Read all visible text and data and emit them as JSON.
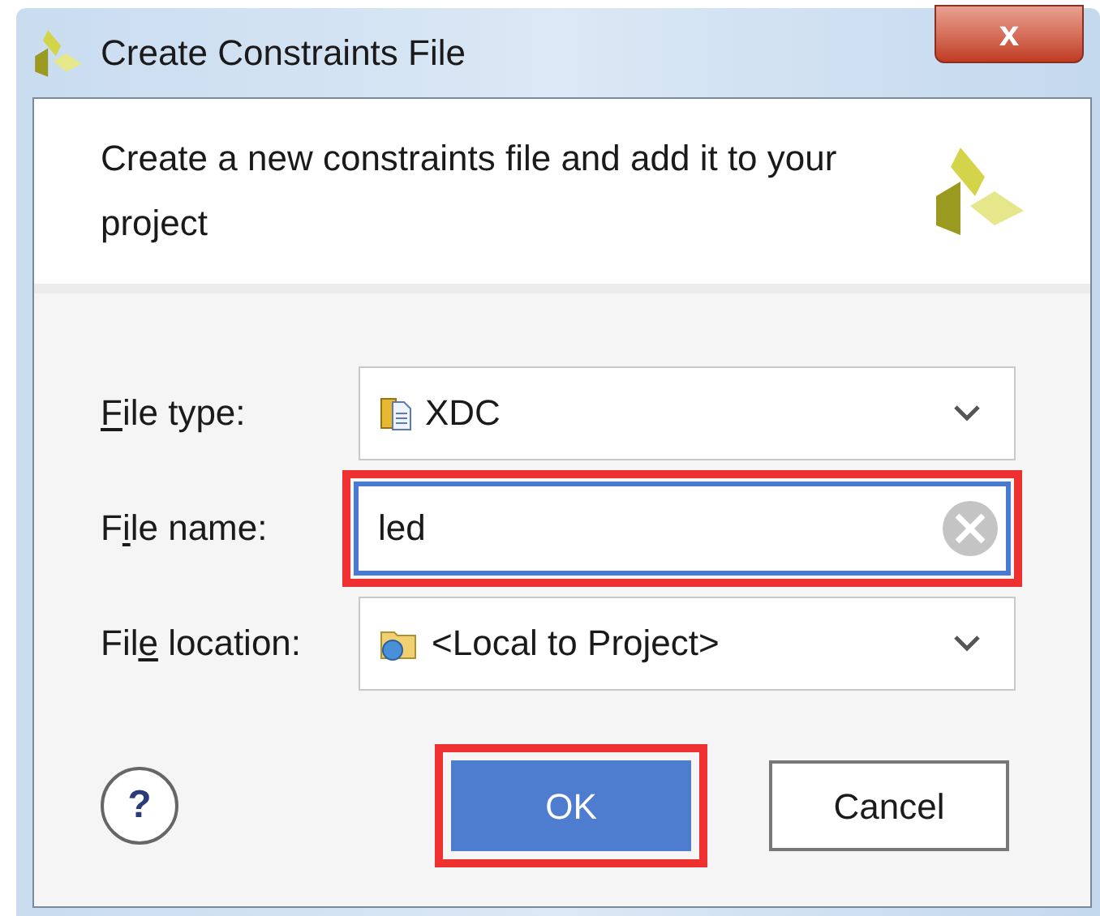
{
  "window": {
    "title": "Create Constraints File",
    "close": "x"
  },
  "header": {
    "text": "Create a new constraints file and add it to your project"
  },
  "fields": [
    {
      "kind": "dropdown",
      "label": [
        {
          "text": "F",
          "mnemonic": true
        },
        {
          "text": "ile type:",
          "mnemonic": false
        }
      ],
      "value": "XDC",
      "focused": false,
      "highlighted": false
    },
    {
      "kind": "text",
      "label": [
        {
          "text": "F",
          "mnemonic": false
        },
        {
          "text": "i",
          "mnemonic": true
        },
        {
          "text": "le name:",
          "mnemonic": false
        }
      ],
      "value": "led",
      "focused": true,
      "highlighted": true
    },
    {
      "kind": "dropdown",
      "label": [
        {
          "text": "Fil",
          "mnemonic": false
        },
        {
          "text": "e",
          "mnemonic": true
        },
        {
          "text": " location:",
          "mnemonic": false
        }
      ],
      "value": "<Local to Project>",
      "focused": false,
      "highlighted": false
    }
  ],
  "help": "?",
  "buttons": [
    {
      "label": "OK",
      "default": true,
      "highlighted": true
    },
    {
      "label": "Cancel",
      "default": false,
      "highlighted": false
    }
  ]
}
